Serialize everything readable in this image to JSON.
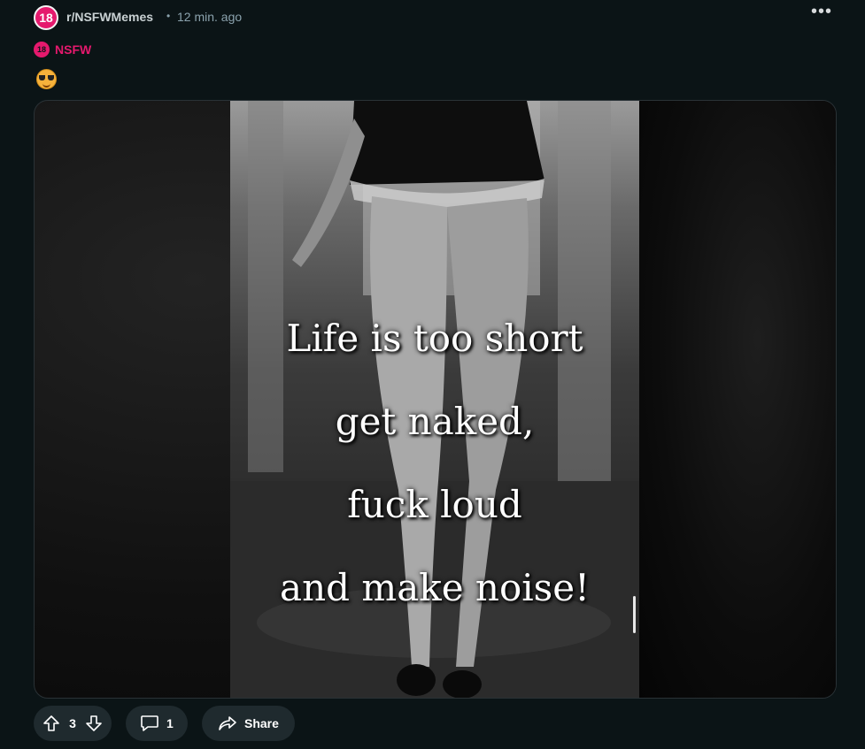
{
  "post": {
    "subreddit": "r/NSFWMemes",
    "subreddit_icon_text": "18",
    "separator": "•",
    "time_ago": "12 min. ago",
    "more_label": "•••",
    "nsfw_icon_text": "18",
    "nsfw_label": "NSFW",
    "flair_icon": "smiling-face-with-sunglasses-emoji",
    "image_caption": [
      "Life is too short",
      "get naked,",
      "fuck loud",
      "and make noise!"
    ]
  },
  "actions": {
    "upvote_icon": "arrow-up-icon",
    "vote_count": "3",
    "downvote_icon": "arrow-down-icon",
    "comment_icon": "speech-bubble-icon",
    "comment_count": "1",
    "share_icon": "share-arrow-icon",
    "share_label": "Share"
  },
  "colors": {
    "background": "#0b1416",
    "nsfw_accent": "#e5196d",
    "pill_bg": "#1f2a2e",
    "muted_text": "#8ba2ad"
  }
}
